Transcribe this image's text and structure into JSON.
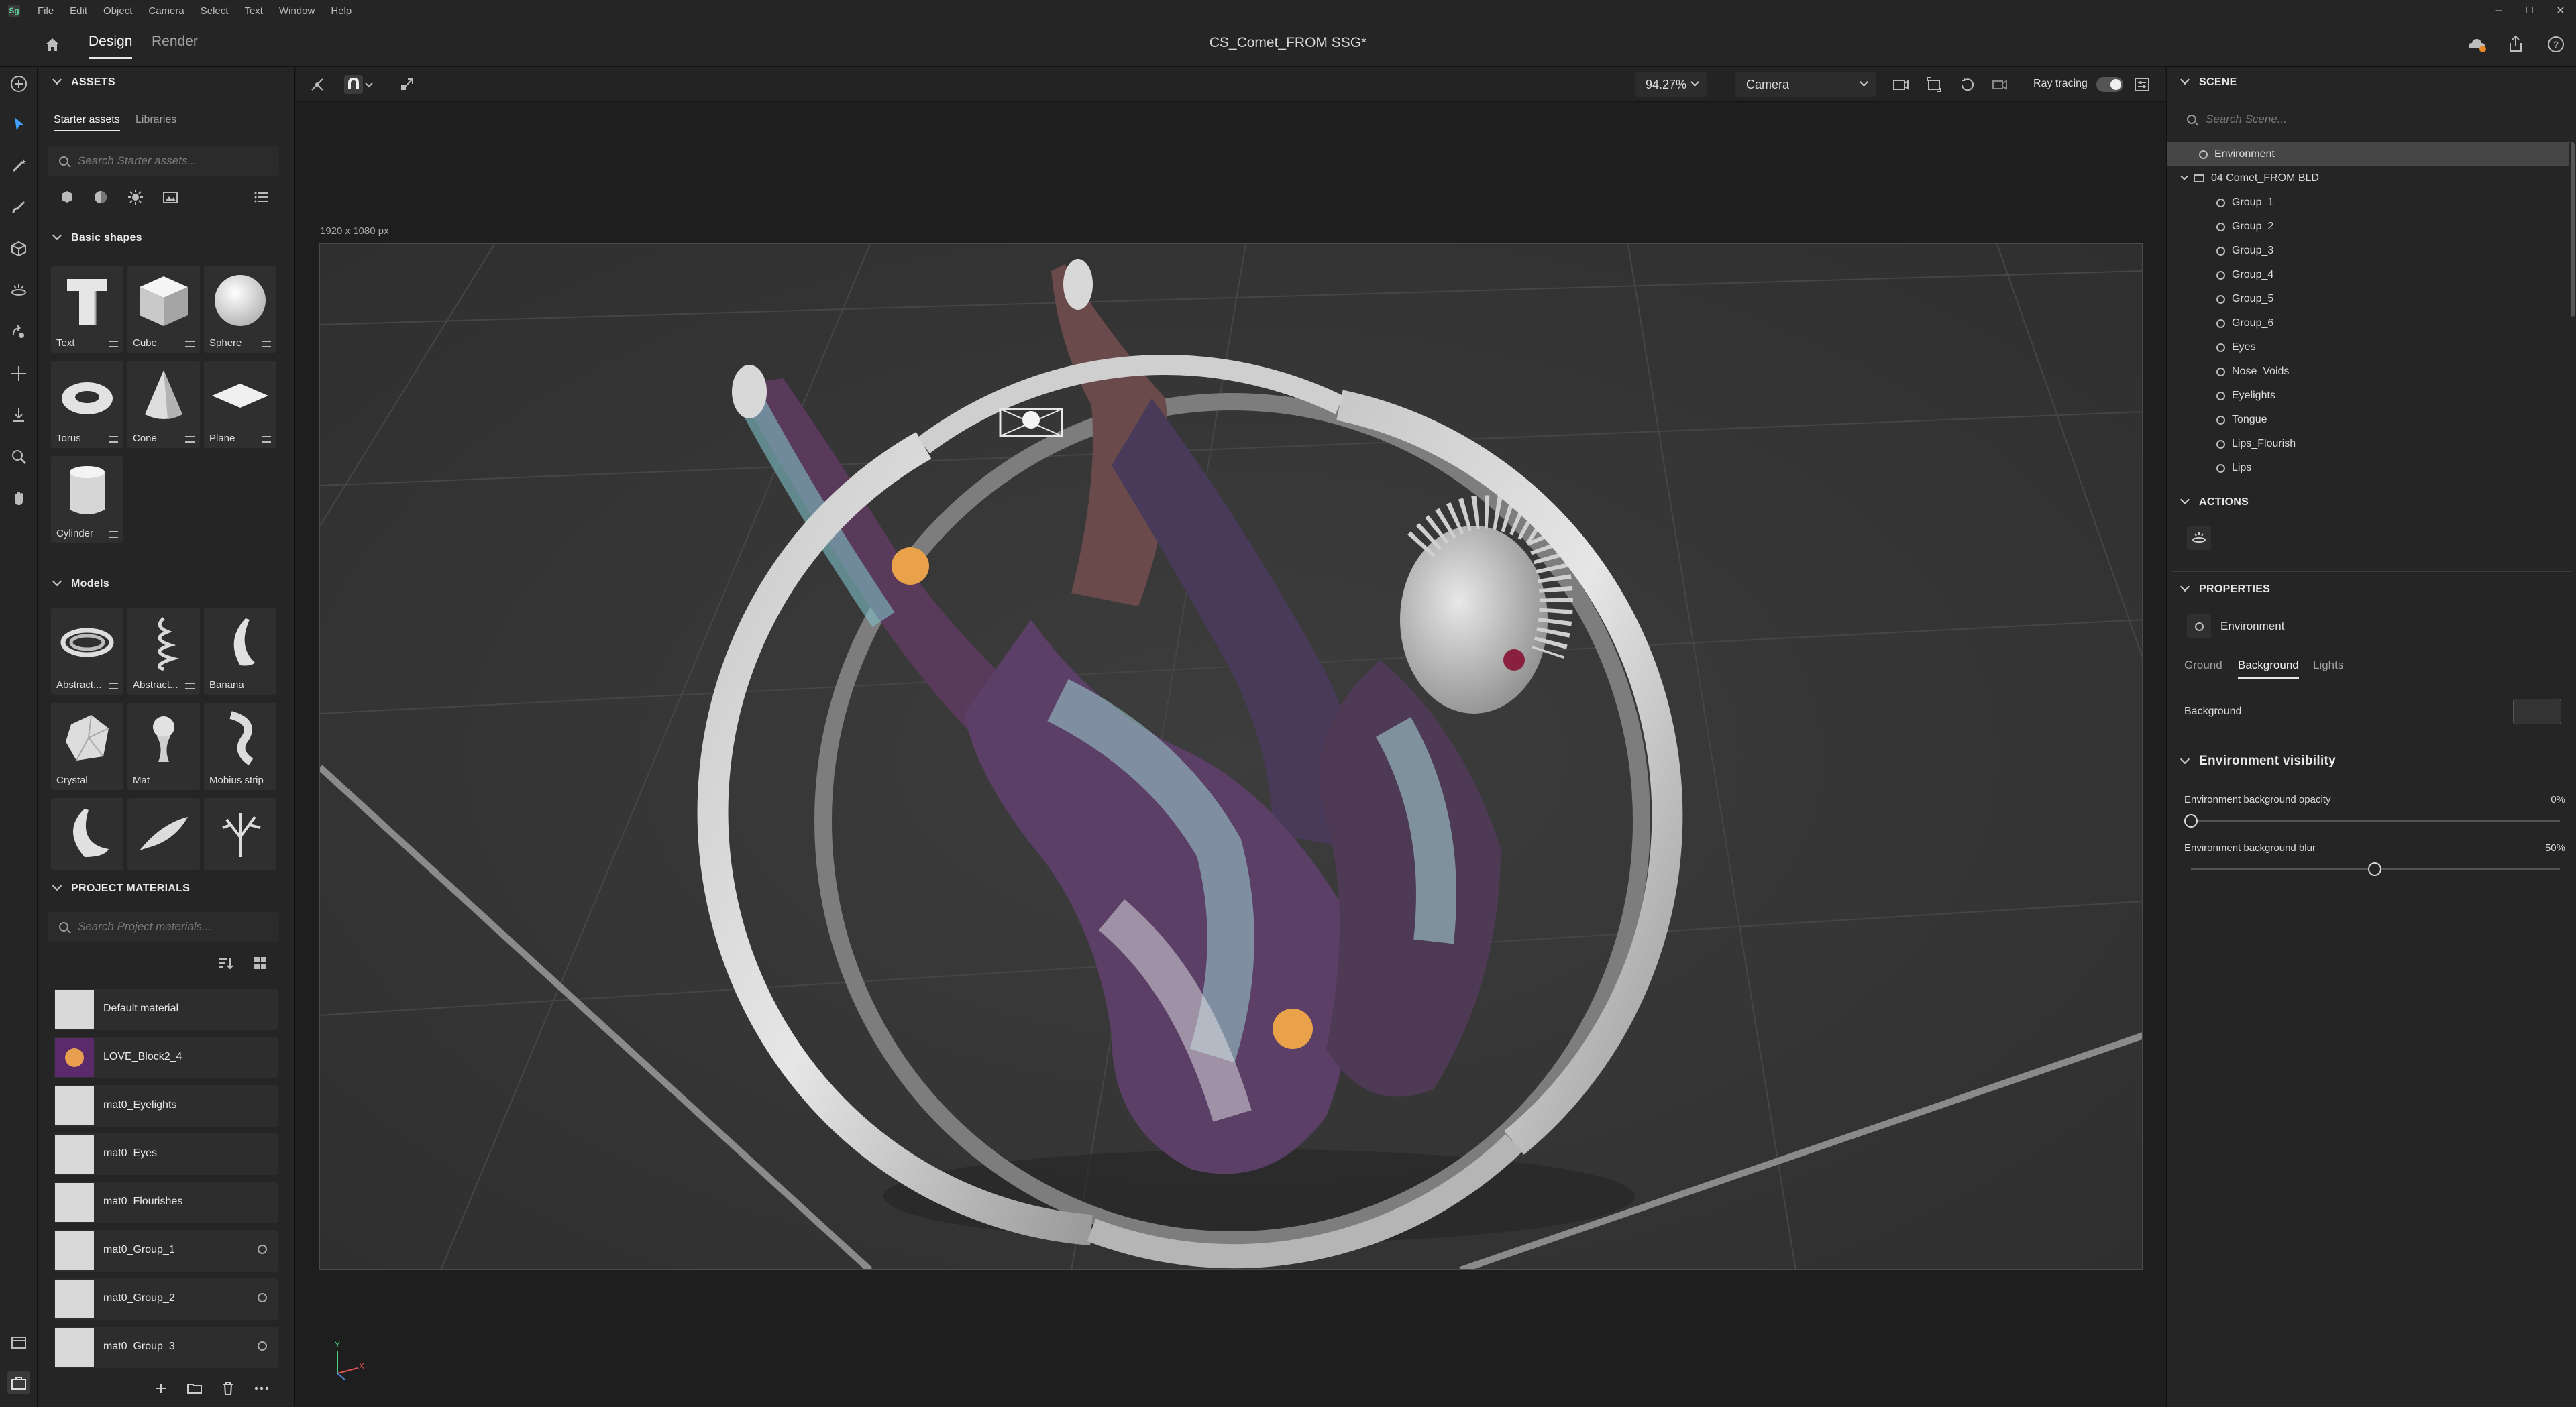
{
  "menubar": {
    "logo": "Sg",
    "items": [
      "File",
      "Edit",
      "Object",
      "Camera",
      "Select",
      "Text",
      "Window",
      "Help"
    ]
  },
  "header": {
    "tabs": [
      "Design",
      "Render"
    ],
    "doc_title": "CS_Comet_FROM SSG*"
  },
  "assets": {
    "title": "ASSETS",
    "subtabs": [
      "Starter assets",
      "Libraries"
    ],
    "search_placeholder": "Search Starter assets...",
    "basic_shapes_title": "Basic shapes",
    "basic_shapes": [
      "Text",
      "Cube",
      "Sphere",
      "Torus",
      "Cone",
      "Plane",
      "Cylinder"
    ],
    "models_title": "Models",
    "models": [
      "Abstract...",
      "Abstract...",
      "Banana",
      "Crystal",
      "Mat",
      "Mobius strip"
    ],
    "project_materials_title": "PROJECT MATERIALS",
    "materials_search_placeholder": "Search Project materials...",
    "materials": [
      "Default material",
      "LOVE_Block2_4",
      "mat0_Eyelights",
      "mat0_Eyes",
      "mat0_Flourishes",
      "mat0_Group_1",
      "mat0_Group_2",
      "mat0_Group_3"
    ]
  },
  "viewport": {
    "zoom": "94.27%",
    "camera": "Camera",
    "ray_tracing_label": "Ray tracing",
    "canvas_size": "1920 x 1080 px",
    "axis_x": "X",
    "axis_y": "Y"
  },
  "scene": {
    "title": "SCENE",
    "search_placeholder": "Search Scene...",
    "environment": "Environment",
    "root": "04 Comet_FROM BLD",
    "children": [
      "Group_1",
      "Group_2",
      "Group_3",
      "Group_4",
      "Group_5",
      "Group_6",
      "Eyes",
      "Nose_Voids",
      "Eyelights",
      "Tongue",
      "Lips_Flourish",
      "Lips"
    ]
  },
  "actions": {
    "title": "ACTIONS"
  },
  "properties": {
    "title": "PROPERTIES",
    "object": "Environment",
    "tabs": [
      "Ground",
      "Background",
      "Lights"
    ],
    "background_label": "Background",
    "visibility_title": "Environment visibility",
    "opacity_label": "Environment background opacity",
    "opacity_value": "0%",
    "blur_label": "Environment background blur",
    "blur_value": "50%"
  },
  "colors": {
    "panel": "#252525",
    "canvas": "#383838",
    "accent": "#e8e8e8"
  }
}
